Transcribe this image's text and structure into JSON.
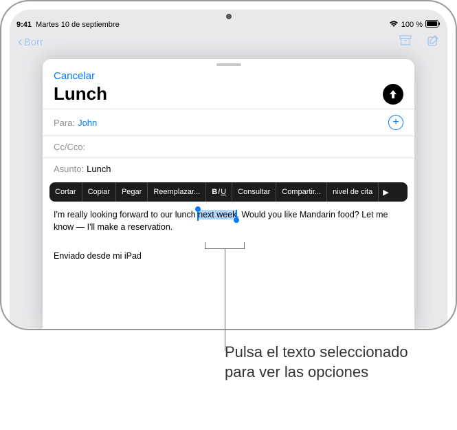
{
  "status": {
    "time": "9:41",
    "date": "Martes 10 de septiembre",
    "battery": "100 %"
  },
  "nav": {
    "back": "Borr"
  },
  "sheet": {
    "cancel": "Cancelar",
    "title": "Lunch",
    "to_label": "Para:",
    "to_value": "John",
    "cc_label": "Cc/Cco:",
    "subject_label": "Asunto:",
    "subject_value": "Lunch"
  },
  "menu": {
    "cut": "Cortar",
    "copy": "Copiar",
    "paste": "Pegar",
    "replace": "Reemplazar...",
    "biu": "B/U",
    "lookup": "Consultar",
    "share": "Compartir...",
    "quote": "nivel de cita"
  },
  "body": {
    "pre": "I'm really looking forward to our lunch ",
    "selected": "next week",
    "post1": ". Would you like Mandarin food? Let me",
    "post2": "know — I'll make a reservation.",
    "signature": "Enviado desde mi iPad"
  },
  "callout": {
    "text": "Pulsa el texto seleccionado para ver las opciones"
  }
}
